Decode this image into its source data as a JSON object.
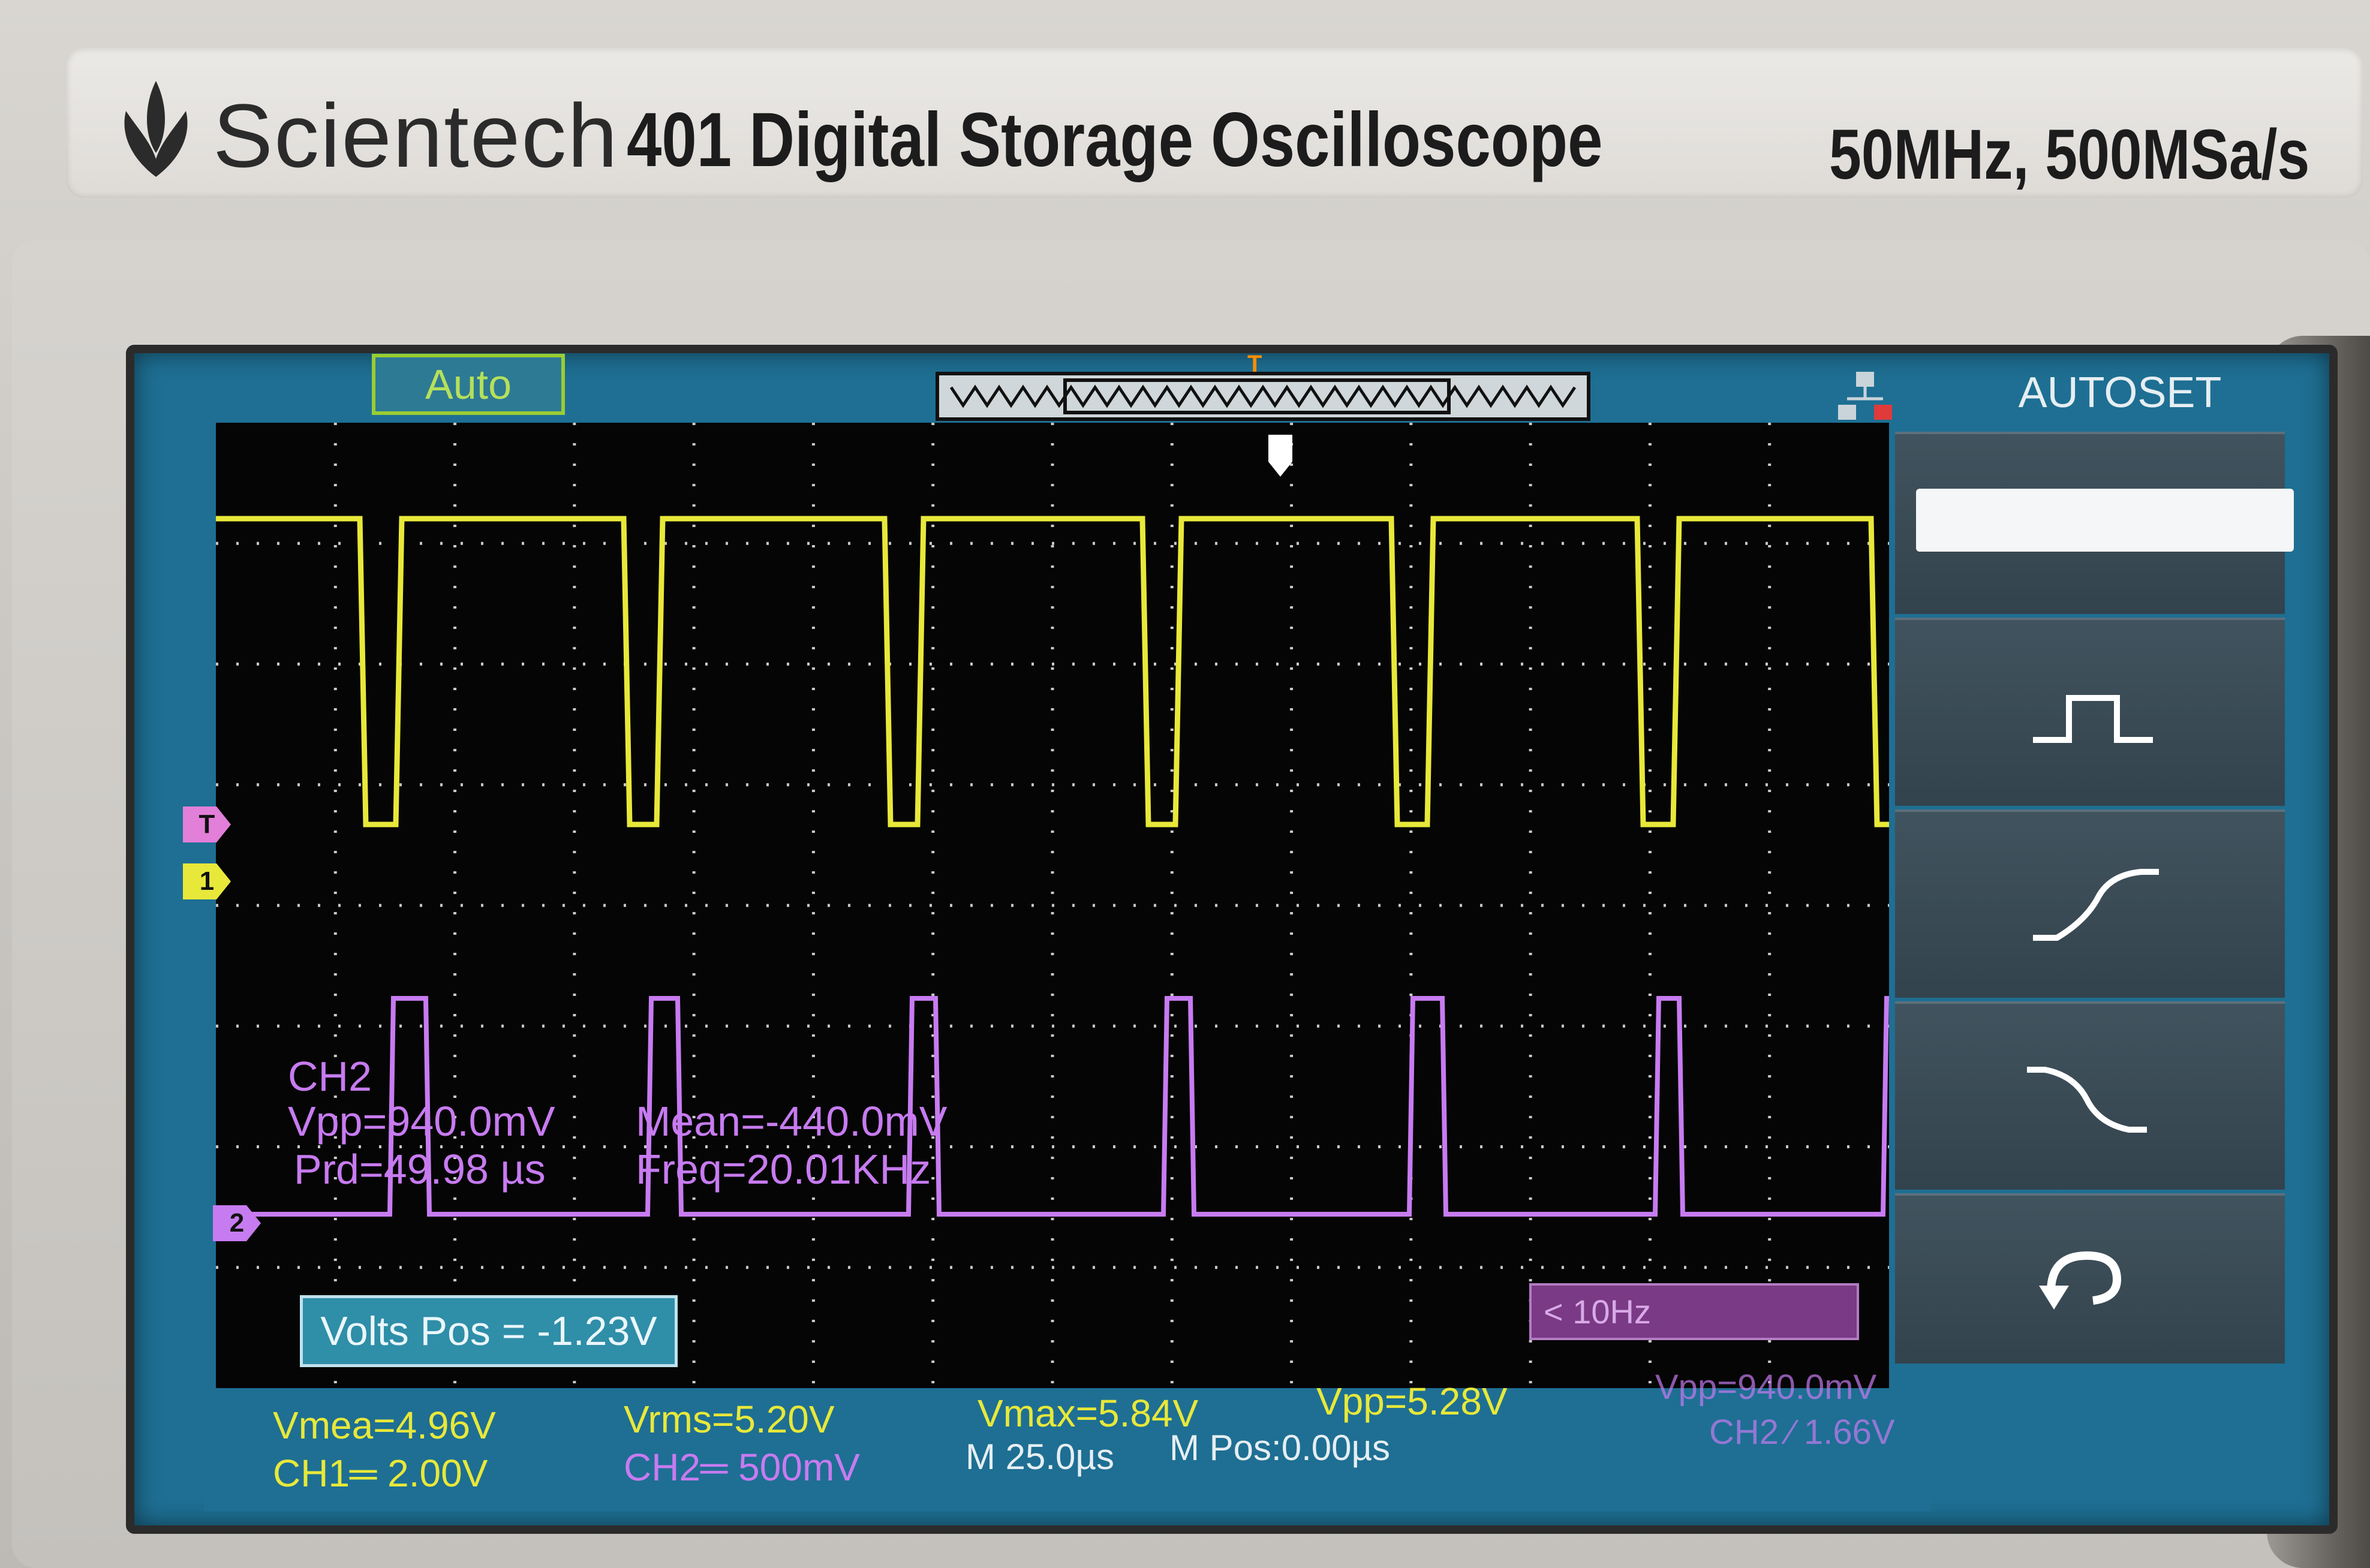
{
  "header": {
    "brand": "Scientech",
    "model": "401 Digital Storage Oscilloscope",
    "spec": "50MHz, 500MSa/s"
  },
  "status": {
    "mode": "Auto",
    "trigger_marker": "T"
  },
  "menu": {
    "title": "AUTOSET",
    "items": [
      {
        "icon": "multi-cycle-icon"
      },
      {
        "icon": "single-pulse-icon"
      },
      {
        "icon": "rising-edge-icon"
      },
      {
        "icon": "falling-edge-icon"
      },
      {
        "icon": "undo-icon"
      }
    ]
  },
  "markers": {
    "trigger": "T",
    "ch1": "1",
    "ch2": "2"
  },
  "ch2_measurements": {
    "label": "CH2",
    "vpp": "Vpp=940.0mV",
    "mean": "Mean=-440.0mV",
    "prd": "Prd=49.98 µs",
    "freq": "Freq=20.01KHz"
  },
  "volts_pos": "Volts Pos = -1.23V",
  "freq_counter": "< 10Hz",
  "bottom": {
    "vmea": "Vmea=4.96V",
    "vrms": "Vrms=5.20V",
    "vmax": "Vmax=5.84V",
    "vpp1": "Vpp=5.28V",
    "vpp2": "Vpp=940.0mV",
    "ch1_scale": "CH1═ 2.00V",
    "ch2_scale": "CH2═ 500mV",
    "time_base": "M 25.0µs",
    "m_pos": "M Pos:0.00µs",
    "ch2_trigger": "CH2 ∕ 1.66V"
  },
  "colors": {
    "ch1": "#e8e83a",
    "ch2": "#c77bf0",
    "screen": "#1e6f93",
    "grid_bg": "#050505"
  }
}
